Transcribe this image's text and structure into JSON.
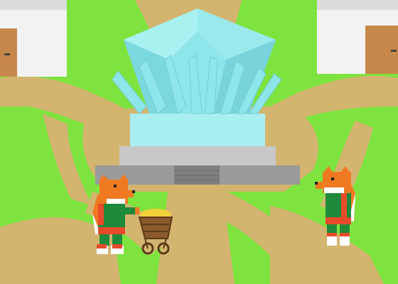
{
  "scene": {
    "type": "game-scene",
    "colors": {
      "grass": "#7ee33f",
      "path": "#d3b570",
      "house_wall": "#f2f2f2",
      "house_shadow": "#dcdcdc",
      "door": "#c8874a",
      "crystal_light": "#a9f1f1",
      "crystal_mid": "#86e2e6",
      "crystal_dark": "#6fcfd6",
      "pedestal_light": "#c8c8c8",
      "pedestal_dark": "#9a9a9a",
      "fox_orange": "#f07a22",
      "fox_shirt": "#1e8a3a",
      "fox_sleeve": "#e84b2a",
      "cart_wood": "#8a5a2c",
      "gold": "#f2d23a"
    },
    "objects": [
      {
        "name": "house-left",
        "icon": "house-icon"
      },
      {
        "name": "house-right",
        "icon": "house-icon"
      },
      {
        "name": "crystal-monument",
        "icon": "crystal-icon"
      },
      {
        "name": "fox-villager-with-cart",
        "icon": "fox-icon"
      },
      {
        "name": "fox-villager-standing",
        "icon": "fox-icon"
      },
      {
        "name": "wooden-cart",
        "icon": "cart-icon"
      }
    ]
  }
}
